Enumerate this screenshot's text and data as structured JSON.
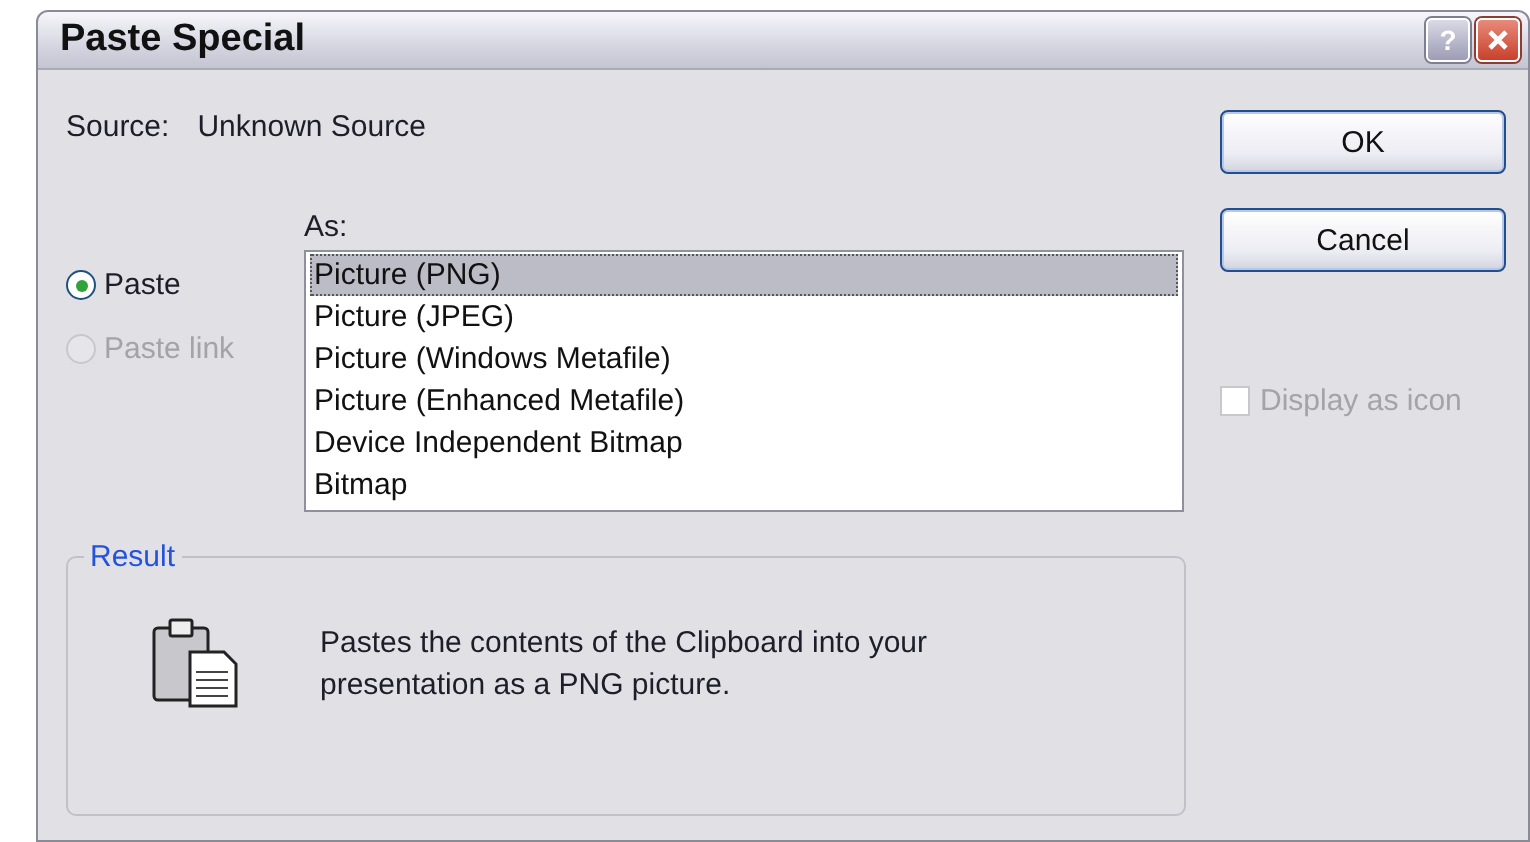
{
  "window": {
    "title": "Paste Special",
    "help": "?"
  },
  "source": {
    "label": "Source:",
    "value": "Unknown Source"
  },
  "as_label": "As:",
  "options": [
    {
      "label": "Paste",
      "selected": true,
      "disabled": false
    },
    {
      "label": "Paste link",
      "selected": false,
      "disabled": true
    }
  ],
  "formats": [
    {
      "label": "Picture (PNG)",
      "selected": true
    },
    {
      "label": "Picture (JPEG)",
      "selected": false
    },
    {
      "label": "Picture (Windows Metafile)",
      "selected": false
    },
    {
      "label": "Picture (Enhanced Metafile)",
      "selected": false
    },
    {
      "label": "Device Independent Bitmap",
      "selected": false
    },
    {
      "label": "Bitmap",
      "selected": false
    }
  ],
  "buttons": [
    "OK",
    "Cancel"
  ],
  "display_as_icon": {
    "label": "Display as icon",
    "checked": false,
    "disabled": true
  },
  "result": {
    "title": "Result",
    "text": "Pastes the contents of the Clipboard into your presentation as a PNG picture."
  }
}
